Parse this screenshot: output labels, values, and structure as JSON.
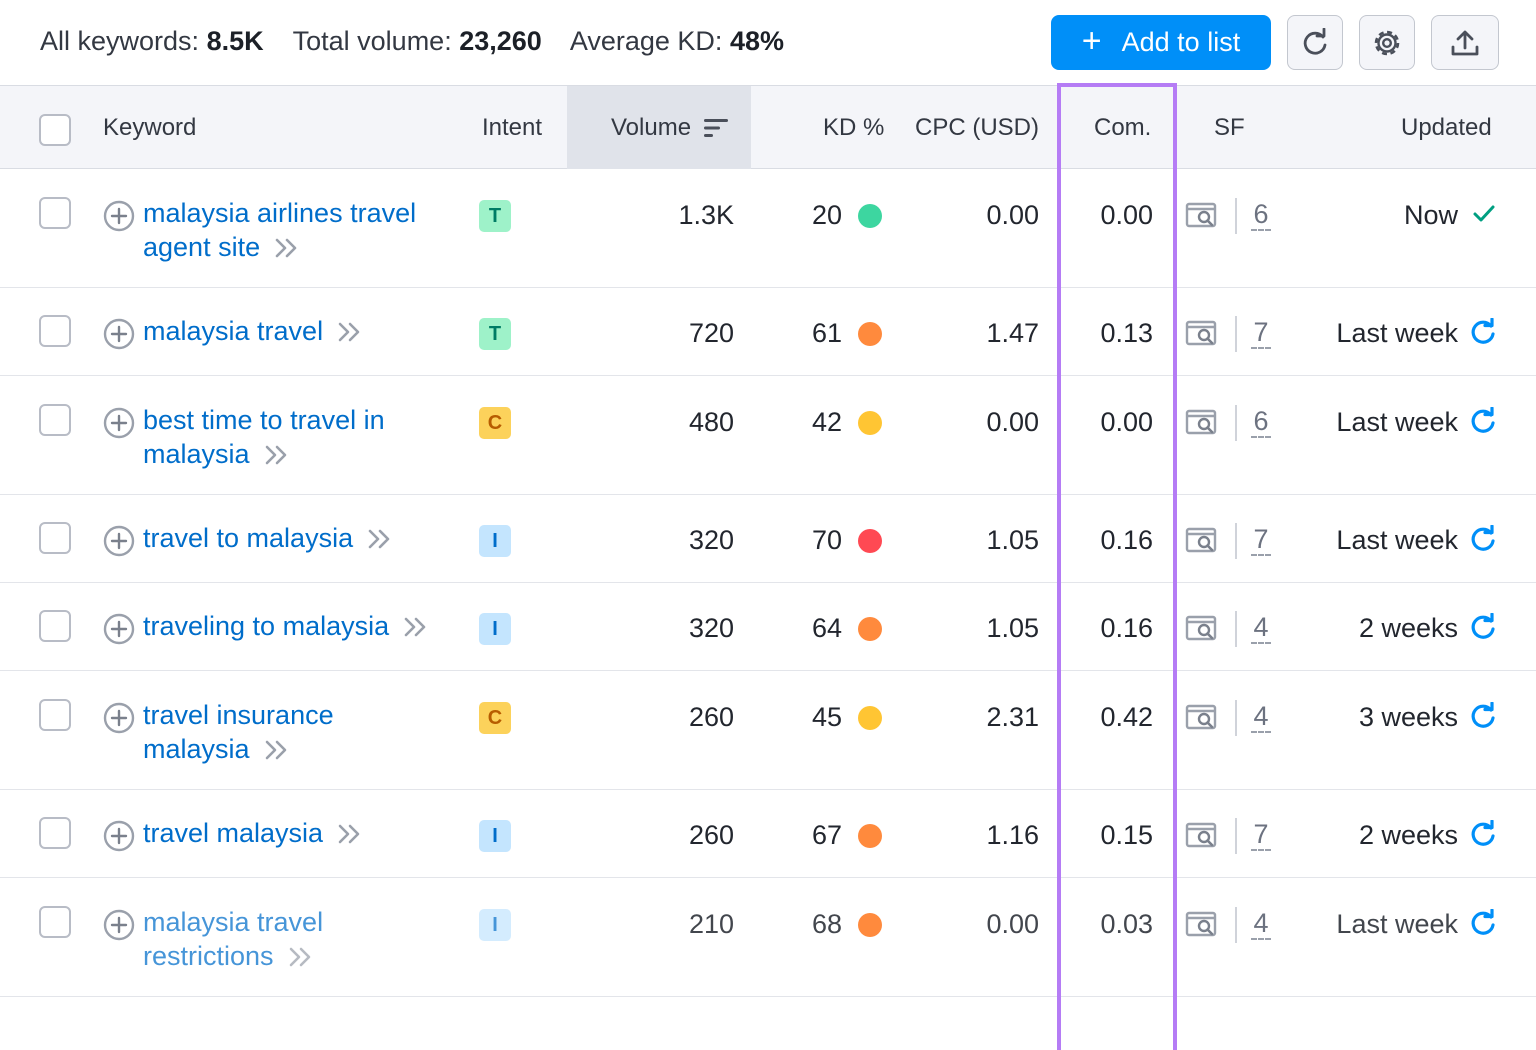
{
  "summary": {
    "all_keywords_label": "All keywords:",
    "all_keywords_value": "8.5K",
    "total_volume_label": "Total volume:",
    "total_volume_value": "23,260",
    "average_kd_label": "Average KD:",
    "average_kd_value": "48%"
  },
  "toolbar": {
    "add_to_list_label": "Add to list",
    "add_icon": "plus-icon",
    "refresh_icon": "refresh-icon",
    "settings_icon": "gear-icon",
    "export_icon": "upload-icon"
  },
  "columns": {
    "keyword": "Keyword",
    "intent": "Intent",
    "volume": "Volume",
    "kd": "KD %",
    "cpc": "CPC (USD)",
    "com": "Com.",
    "sf": "SF",
    "updated": "Updated"
  },
  "colors": {
    "accent": "#008ff8",
    "link": "#006dca",
    "highlight": "#b57cf5",
    "kd_green": "#3dd6a0",
    "kd_orange": "#ff8a3d",
    "kd_yellow": "#ffc533",
    "kd_red": "#ff4953"
  },
  "rows": [
    {
      "kw_line1": "malaysia airlines travel",
      "kw_line2": "agent site",
      "intent": "T",
      "volume": "1.3K",
      "kd": "20",
      "kd_level": "green",
      "cpc": "0.00",
      "com": "0.00",
      "sf": "6",
      "updated": "Now",
      "updated_icon": "check-icon"
    },
    {
      "kw_line1": "malaysia travel",
      "kw_line2": "",
      "intent": "T",
      "volume": "720",
      "kd": "61",
      "kd_level": "orange",
      "cpc": "1.47",
      "com": "0.13",
      "sf": "7",
      "updated": "Last week",
      "updated_icon": "refresh-icon"
    },
    {
      "kw_line1": "best time to travel in",
      "kw_line2": "malaysia",
      "intent": "C",
      "volume": "480",
      "kd": "42",
      "kd_level": "yellow",
      "cpc": "0.00",
      "com": "0.00",
      "sf": "6",
      "updated": "Last week",
      "updated_icon": "refresh-icon"
    },
    {
      "kw_line1": "travel to malaysia",
      "kw_line2": "",
      "intent": "I",
      "volume": "320",
      "kd": "70",
      "kd_level": "red",
      "cpc": "1.05",
      "com": "0.16",
      "sf": "7",
      "updated": "Last week",
      "updated_icon": "refresh-icon"
    },
    {
      "kw_line1": "traveling to malaysia",
      "kw_line2": "",
      "intent": "I",
      "volume": "320",
      "kd": "64",
      "kd_level": "orange",
      "cpc": "1.05",
      "com": "0.16",
      "sf": "4",
      "updated": "2 weeks",
      "updated_icon": "refresh-icon"
    },
    {
      "kw_line1": "travel insurance",
      "kw_line2": "malaysia",
      "intent": "C",
      "volume": "260",
      "kd": "45",
      "kd_level": "yellow",
      "cpc": "2.31",
      "com": "0.42",
      "sf": "4",
      "updated": "3 weeks",
      "updated_icon": "refresh-icon"
    },
    {
      "kw_line1": "travel malaysia",
      "kw_line2": "",
      "intent": "I",
      "volume": "260",
      "kd": "67",
      "kd_level": "orange",
      "cpc": "1.16",
      "com": "0.15",
      "sf": "7",
      "updated": "2 weeks",
      "updated_icon": "refresh-icon"
    },
    {
      "kw_line1": "malaysia travel",
      "kw_line2": "restrictions",
      "intent": "I",
      "volume": "210",
      "kd": "68",
      "kd_level": "orange",
      "cpc": "0.00",
      "com": "0.03",
      "sf": "4",
      "updated": "Last week",
      "updated_icon": "refresh-icon"
    }
  ]
}
